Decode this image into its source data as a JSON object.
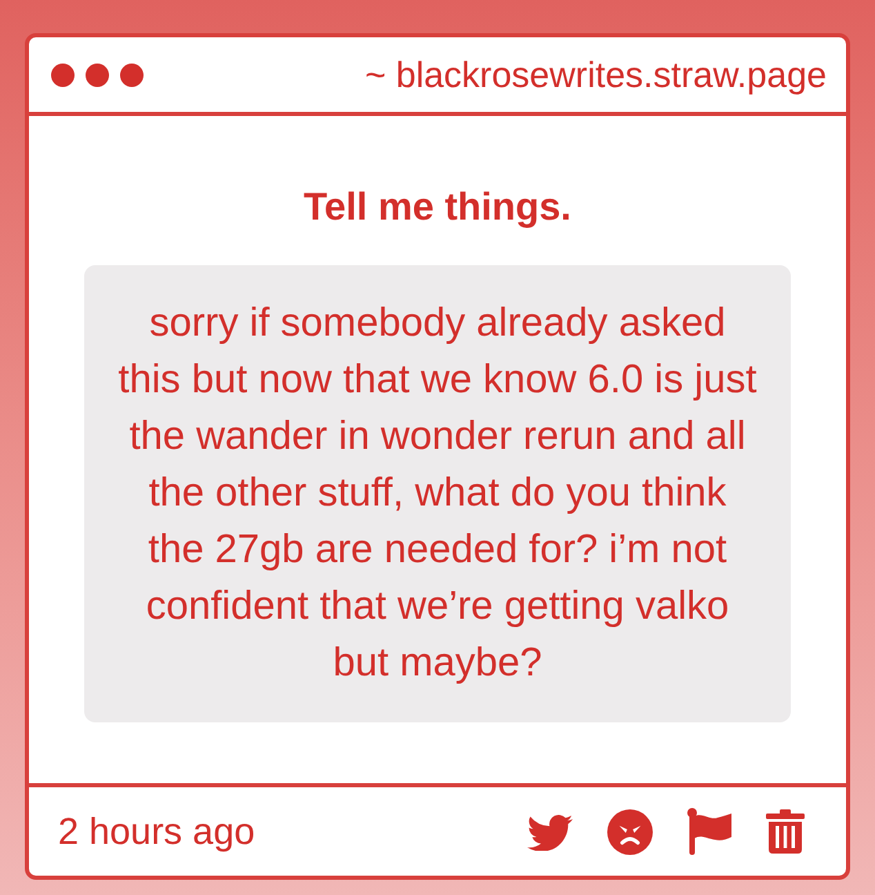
{
  "window": {
    "address": "~ blackrosewrites.straw.page"
  },
  "page": {
    "title": "Tell me things.",
    "message": "sorry if somebody already asked this but now that we know 6.0 is just the wander in wonder rerun and all the other stuff, what do you think the 27gb are needed for? i’m not confident that we’re getting valko but maybe?"
  },
  "footer": {
    "time": "2 hours ago"
  }
}
